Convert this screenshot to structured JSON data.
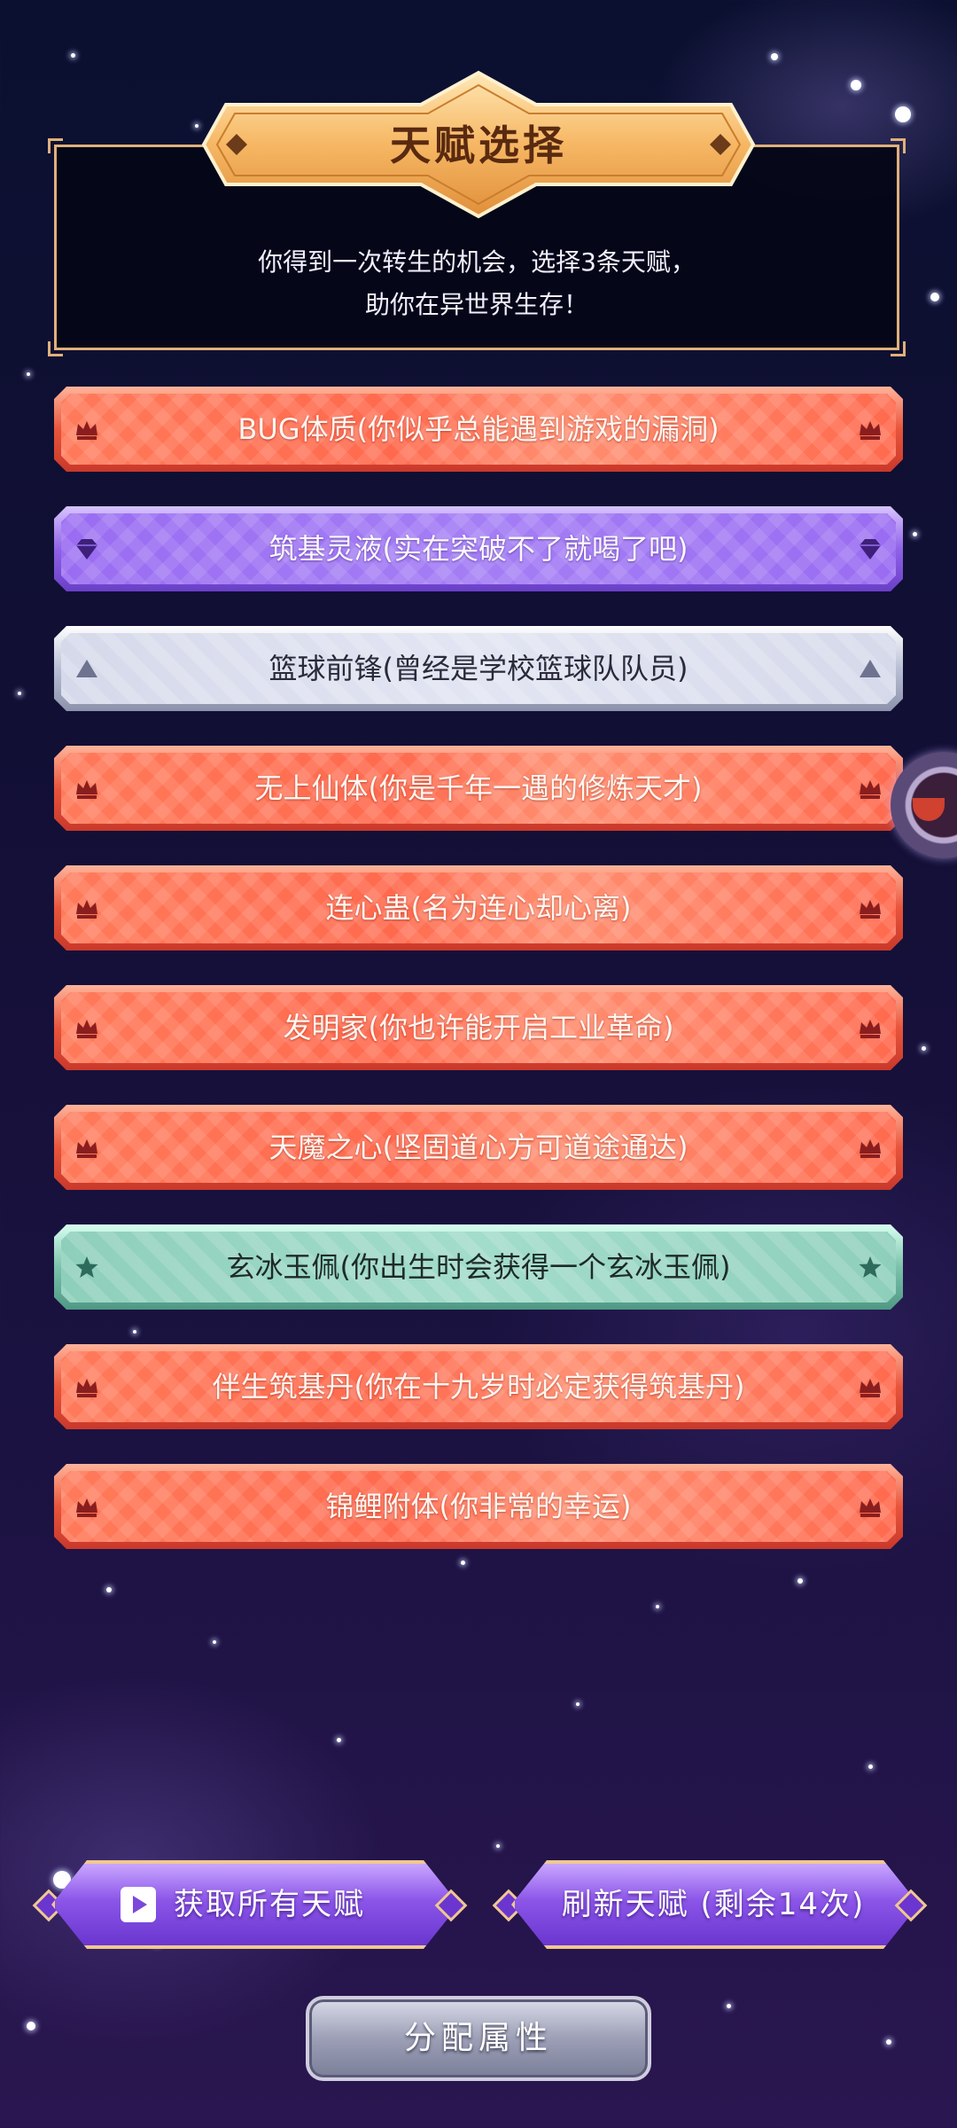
{
  "header": {
    "title": "天赋选择",
    "subtitle_line1": "你得到一次转生的机会，选择3条天赋，",
    "subtitle_line2": "助你在异世界生存！"
  },
  "talents": [
    {
      "label": "BUG体质(你似乎总能遇到游戏的漏洞)",
      "rarity": "red",
      "icon": "crown-icon"
    },
    {
      "label": "筑基灵液(实在突破不了就喝了吧)",
      "rarity": "purple",
      "icon": "gem-icon"
    },
    {
      "label": "篮球前锋(曾经是学校篮球队队员)",
      "rarity": "silver",
      "icon": "triangle-icon"
    },
    {
      "label": "无上仙体(你是千年一遇的修炼天才)",
      "rarity": "red",
      "icon": "crown-icon"
    },
    {
      "label": "连心蛊(名为连心却心离)",
      "rarity": "red",
      "icon": "crown-icon"
    },
    {
      "label": "发明家(你也许能开启工业革命)",
      "rarity": "red",
      "icon": "crown-icon"
    },
    {
      "label": "天魔之心(坚固道心方可道途通达)",
      "rarity": "red",
      "icon": "crown-icon"
    },
    {
      "label": "玄冰玉佩(你出生时会获得一个玄冰玉佩)",
      "rarity": "teal",
      "icon": "star-icon"
    },
    {
      "label": "伴生筑基丹(你在十九岁时必定获得筑基丹)",
      "rarity": "red",
      "icon": "crown-icon"
    },
    {
      "label": "锦鲤附体(你非常的幸运)",
      "rarity": "red",
      "icon": "crown-icon"
    }
  ],
  "buttons": {
    "get_all": "获取所有天赋",
    "refresh": "刷新天赋 (剩余14次)",
    "allocate": "分配属性"
  },
  "colors": {
    "accent_gold": "#e0b07a",
    "red": "#ff6a4e",
    "purple": "#9a6cf2",
    "silver": "#d5d9ea",
    "teal": "#8ecfbb"
  }
}
